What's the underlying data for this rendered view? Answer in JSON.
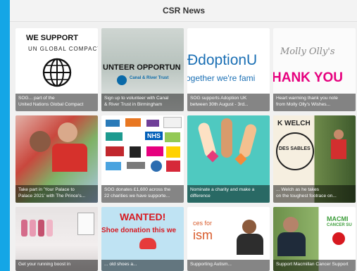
{
  "header": {
    "title": "CSR News"
  },
  "tiles": [
    {
      "art": {
        "heading": "WE SUPPORT",
        "ring": "UN GLOBAL COMPACT",
        "icon": "globe-icon"
      },
      "caption": [
        "SOG... part of the",
        "United Nations Global Compact"
      ]
    },
    {
      "art": {
        "banner": "UNTEER OPPORTUN",
        "logo": "Canal & River Trust"
      },
      "caption": [
        "Sign up to volunteer with Canal",
        "& River Trust in Birmingham"
      ]
    },
    {
      "art": {
        "line1": "ĐdoptionU",
        "line2": "ogether we're fami"
      },
      "caption": [
        "SOG supports Adoption UK",
        "between 30th August - 3rd..."
      ]
    },
    {
      "art": {
        "brand": "Molly Olly's",
        "line": "HANK YOU"
      },
      "caption": [
        "Heart warming thank you note",
        "from Molly Olly's Wishes..."
      ]
    },
    {
      "art": {
        "scene": "runners-photo"
      },
      "caption": [
        "Take part in 'Your Palace to",
        "Palace 2021' with The Prince's..."
      ]
    },
    {
      "art": {
        "scene": "charity-logos",
        "logos": [
          "NHS"
        ]
      },
      "caption": [
        "SOG donates £1,600 across the",
        "22 charities we have supporte..."
      ]
    },
    {
      "art": {
        "scene": "raised-hands"
      },
      "caption": [
        "Nominate a charity and make a",
        "difference"
      ]
    },
    {
      "art": {
        "brand": "K WELCH",
        "badge": "DES SABLES"
      },
      "caption": [
        "... Welch as he takes",
        "on the toughest footrace on..."
      ]
    },
    {
      "art": {
        "scene": "shoe-bench"
      },
      "caption": [
        "Get your running boost in"
      ]
    },
    {
      "art": {
        "heading": "WANTED!",
        "sub": "Shoe donation this we"
      },
      "caption": [
        "... old shoes a..."
      ]
    },
    {
      "art": {
        "line": "ism",
        "pre": "ces for"
      },
      "caption": [
        "Supporting Autism..."
      ]
    },
    {
      "art": {
        "logo": "MACMI",
        "sub": "CANCER SU"
      },
      "caption": [
        "Support Macmillan Cancer Support"
      ]
    }
  ],
  "colors": {
    "background": "#14a6e6",
    "panel": "#f1f1f1",
    "caption_overlay": "rgba(0,0,0,0.48)",
    "adoption_blue": "#1a6fb4",
    "thankyou_pink": "#e6007e",
    "wanted_red": "#d71920",
    "nominate_teal": "#4fc9c0",
    "macmillan_green": "#3c9d3a"
  }
}
